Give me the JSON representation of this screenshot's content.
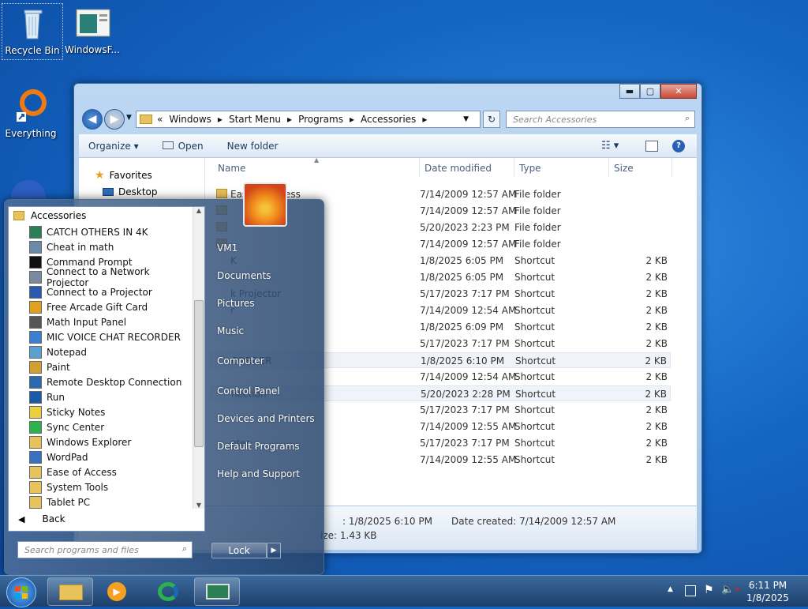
{
  "desktop": {
    "recycle_bin": "Recycle Bin",
    "windows_f": "WindowsF...",
    "everything": "Everything"
  },
  "explorer": {
    "title_buttons": {
      "minimize": "▬",
      "maximize": "▢",
      "close": "✕"
    },
    "address": {
      "root": "«",
      "segments": [
        "Windows",
        "Start Menu",
        "Programs",
        "Accessories"
      ]
    },
    "search_placeholder": "Search Accessories",
    "toolbar": {
      "organize": "Organize",
      "open": "Open",
      "new_folder": "New folder"
    },
    "nav": {
      "favorites": "Favorites",
      "desktop": "Desktop"
    },
    "columns": {
      "name": "Name",
      "date": "Date modified",
      "type": "Type",
      "size": "Size"
    },
    "rows": [
      {
        "name": "Ease of Access",
        "date": "7/14/2009 12:57 AM",
        "type": "File folder",
        "size": ""
      },
      {
        "name": "",
        "date": "7/14/2009 12:57 AM",
        "type": "File folder",
        "size": ""
      },
      {
        "name": "",
        "date": "5/20/2023 2:23 PM",
        "type": "File folder",
        "size": ""
      },
      {
        "name": "",
        "date": "7/14/2009 12:57 AM",
        "type": "File folder",
        "size": ""
      },
      {
        "name": "K",
        "date": "1/8/2025 6:05 PM",
        "type": "Shortcut",
        "size": "2 KB"
      },
      {
        "name": "",
        "date": "1/8/2025 6:05 PM",
        "type": "Shortcut",
        "size": "2 KB"
      },
      {
        "name": "k Projector",
        "date": "5/17/2023 7:17 PM",
        "type": "Shortcut",
        "size": "2 KB"
      },
      {
        "name": "r",
        "date": "7/14/2009 12:54 AM",
        "type": "Shortcut",
        "size": "2 KB"
      },
      {
        "name": "",
        "date": "1/8/2025 6:09 PM",
        "type": "Shortcut",
        "size": "2 KB"
      },
      {
        "name": "",
        "date": "5/17/2023 7:17 PM",
        "type": "Shortcut",
        "size": "2 KB"
      },
      {
        "name": "CORDER",
        "date": "1/8/2025 6:10 PM",
        "type": "Shortcut",
        "size": "2 KB"
      },
      {
        "name": "",
        "date": "7/14/2009 12:54 AM",
        "type": "Shortcut",
        "size": "2 KB"
      },
      {
        "name": "nection",
        "date": "5/20/2023 2:28 PM",
        "type": "Shortcut",
        "size": "2 KB"
      },
      {
        "name": "",
        "date": "5/17/2023 7:17 PM",
        "type": "Shortcut",
        "size": "2 KB"
      },
      {
        "name": "",
        "date": "7/14/2009 12:55 AM",
        "type": "Shortcut",
        "size": "2 KB"
      },
      {
        "name": "nter",
        "date": "5/17/2023 7:17 PM",
        "type": "Shortcut",
        "size": "2 KB"
      },
      {
        "name": "",
        "date": "7/14/2009 12:55 AM",
        "type": "Shortcut",
        "size": "2 KB"
      }
    ],
    "details": {
      "modified": "1/8/2025 6:10 PM",
      "created_label": "Date created:",
      "created": "7/14/2009 12:57 AM",
      "size": "1.43 KB"
    }
  },
  "start_menu": {
    "folder": "Accessories",
    "programs": [
      "CATCH OTHERS IN 4K",
      "Cheat in math",
      "Command Prompt",
      "Connect to a Network Projector",
      "Connect to a Projector",
      "Free Arcade Gift Card",
      "Math Input Panel",
      "MIC VOICE CHAT RECORDER",
      "Notepad",
      "Paint",
      "Remote Desktop Connection",
      "Run",
      "Sticky Notes",
      "Sync Center",
      "Windows Explorer",
      "WordPad",
      "Ease of Access",
      "System Tools",
      "Tablet PC"
    ],
    "back": "Back",
    "search_placeholder": "Search programs and files",
    "right": [
      "VM1",
      "Documents",
      "Pictures",
      "Music",
      "Computer",
      "Control Panel",
      "Devices and Printers",
      "Default Programs",
      "Help and Support"
    ],
    "lock": "Lock"
  },
  "taskbar": {
    "time": "6:11 PM",
    "date": "1/8/2025"
  }
}
